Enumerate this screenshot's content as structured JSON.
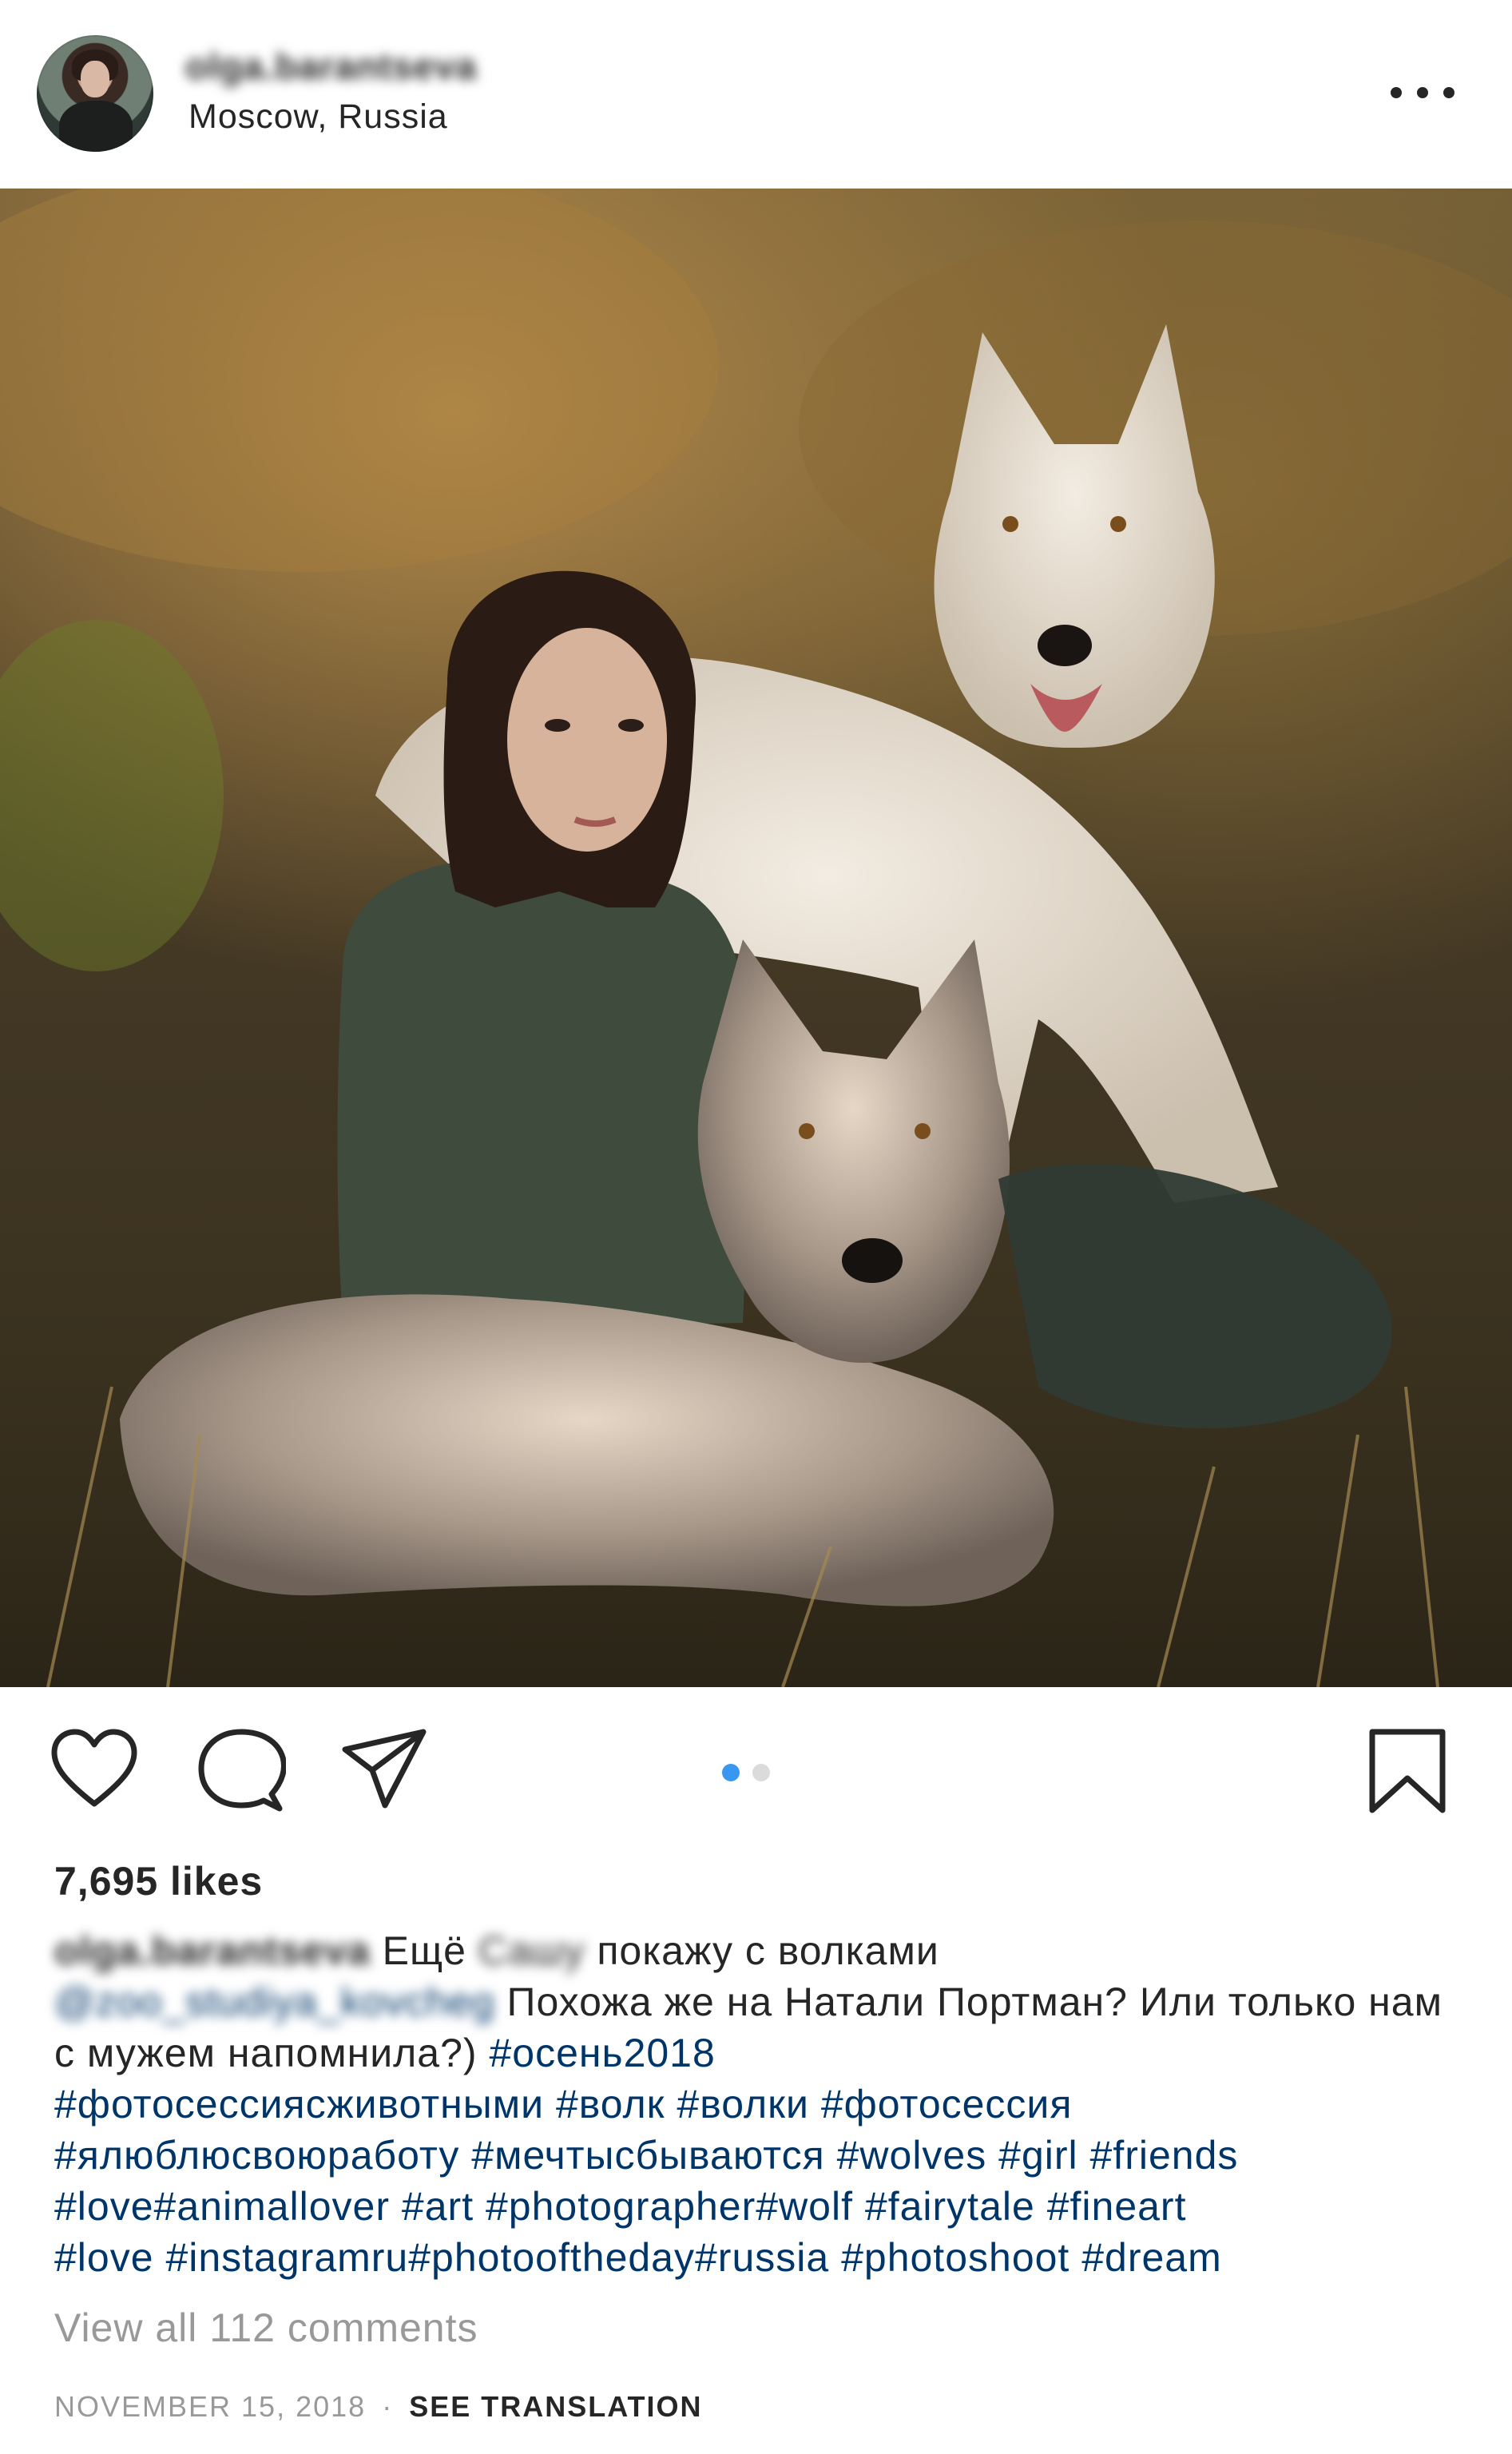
{
  "header": {
    "username": "olga.barantseva",
    "location": "Moscow, Russia",
    "more_icon": "more-horizontal-icon"
  },
  "post": {
    "photo_alt": "",
    "carousel": {
      "total": 2,
      "active_index": 0
    },
    "icons": [
      "heart-icon",
      "comment-icon",
      "share-icon",
      "bookmark-icon"
    ]
  },
  "stats": {
    "likes": "7,695 likes"
  },
  "caption": {
    "author": "olga.barantseva",
    "text1": "Ещё",
    "blurred_name": "Сашу",
    "text2": "покажу с волками",
    "mention": "@zoo_studiya_kovcheg",
    "text3": "Похожа же на Натали Портман? Или только нам с мужем напомнила?)",
    "hashtags": [
      "#осень2018",
      "#фотосессиясживотными",
      "#волк",
      "#волки",
      "#фотосессия",
      "#ялюблюсвоюработу",
      "#мечтысбываются",
      "#wolves",
      "#girl",
      "#friends",
      "#love#animallover",
      "#art",
      "#photographer#wolf",
      "#fairytale",
      "#fineart",
      "#love",
      "#instagramru#photooftheday#russia",
      "#photoshoot",
      "#dream"
    ]
  },
  "comments": {
    "view_all": "View all 112 comments"
  },
  "meta": {
    "date": "NOVEMBER 15, 2018",
    "separator": "·",
    "see_translation": "SEE TRANSLATION"
  },
  "colors": {
    "text": "#262626",
    "link": "#003569",
    "muted": "#999999",
    "carousel_active": "#3897f0",
    "carousel_inactive": "#dbdbdb"
  }
}
